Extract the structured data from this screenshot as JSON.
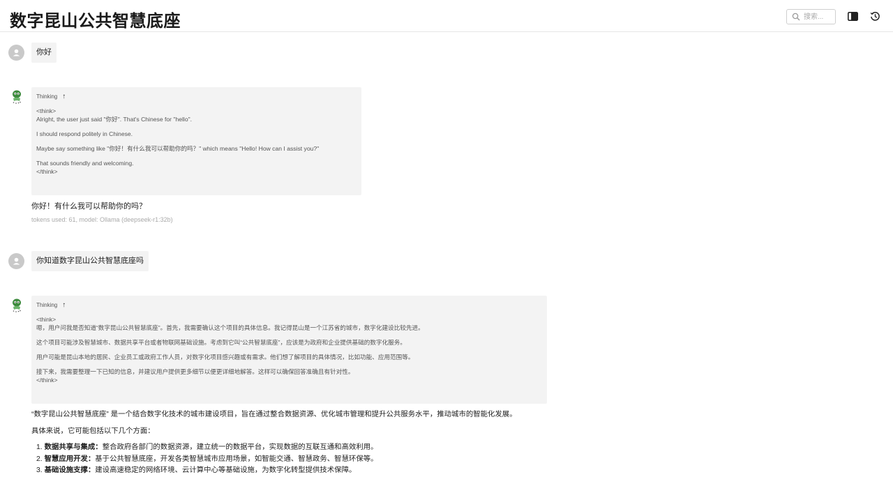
{
  "app": {
    "title": "数字昆山公共智慧底座"
  },
  "search": {
    "placeholder": "搜索..."
  },
  "icons": {
    "search": "search-icon",
    "panel": "panel-toggle-icon",
    "history": "history-icon",
    "user_avatar": "user-avatar-icon",
    "bot_avatar": "bot-avatar-icon",
    "collapse": "arrow-up-icon"
  },
  "messages": [
    {
      "role": "user",
      "text": "你好"
    },
    {
      "role": "assistant",
      "thinking_label": "Thinking",
      "collapse_glyph": "↑",
      "thinking": [
        "<think>",
        "Alright, the user just said \"你好\". That's Chinese for \"hello\".",
        "",
        "I should respond politely in Chinese.",
        "",
        "Maybe say something like \"你好！有什么我可以帮助你的吗？\" which means \"Hello! How can I assist you?\"",
        "",
        "That sounds friendly and welcoming.",
        "</think>"
      ],
      "answer": "你好！有什么我可以帮助你的吗？",
      "meta": "tokens used: 61, model: Ollama (deepseek-r1:32b)"
    },
    {
      "role": "user",
      "text": "你知道数字昆山公共智慧底座吗"
    },
    {
      "role": "assistant",
      "thinking_label": "Thinking",
      "collapse_glyph": "↑",
      "thinking": [
        "<think>",
        "嗯，用户问我是否知道“数字昆山公共智慧底座”。首先，我需要确认这个项目的具体信息。我记得昆山是一个江苏省的城市，数字化建设比较先进。",
        "",
        "这个项目可能涉及智慧城市、数据共享平台或者物联网基础设施。考虑到它叫“公共智慧底座”，应该是为政府和企业提供基础的数字化服务。",
        "",
        "用户可能是昆山本地的居民、企业员工或政府工作人员，对数字化项目感兴趣或有需求。他们想了解项目的具体情况，比如功能、应用范围等。",
        "",
        "接下来，我需要整理一下已知的信息，并建议用户提供更多细节以便更详细地解答。这样可以确保回答准确且有针对性。",
        "</think>"
      ],
      "answer": "“数字昆山公共智慧底座” 是一个结合数字化技术的城市建设项目，旨在通过整合数据资源、优化城市管理和提升公共服务水平，推动城市的智能化发展。",
      "answer2": "具体来说，它可能包括以下几个方面：",
      "list": [
        {
          "num": "1.",
          "title": "数据共享与集成：",
          "text": "整合政府各部门的数据资源，建立统一的数据平台，实现数据的互联互通和高效利用。"
        },
        {
          "num": "2.",
          "title": "智慧应用开发：",
          "text": "基于公共智慧底座，开发各类智慧城市应用场景，如智能交通、智慧政务、智慧环保等。"
        },
        {
          "num": "3.",
          "title": "基础设施支撑：",
          "text": "建设高速稳定的网络环境、云计算中心等基础设施，为数字化转型提供技术保障。"
        }
      ]
    }
  ]
}
